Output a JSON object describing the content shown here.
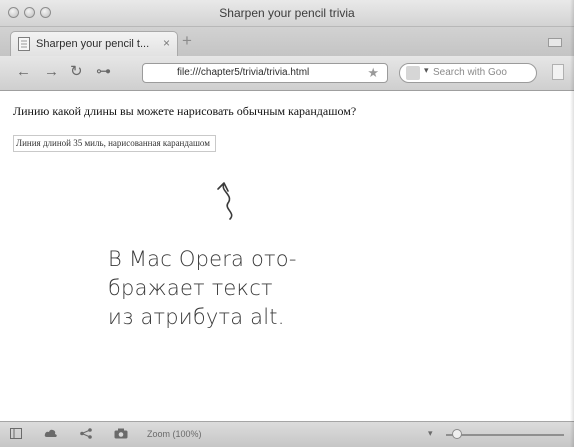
{
  "window": {
    "title": "Sharpen your pencil trivia"
  },
  "tab": {
    "title": "Sharpen your pencil t...",
    "close_glyph": "×",
    "new_tab_glyph": "+"
  },
  "navbar": {
    "back_glyph": "←",
    "forward_glyph": "→",
    "reload_glyph": "↻",
    "home_glyph": "⊶",
    "url": "file:///chapter5/trivia/trivia.html",
    "bookmark_glyph": "★",
    "search_placeholder": "Search with Goo",
    "search_dropdown_glyph": "▾"
  },
  "page": {
    "question": "Линию какой длины вы можете нарисовать обычным карандашом?",
    "alt_text": "Линия длиной 35 миль, нарисованная карандашом"
  },
  "annotation": {
    "lines": [
      "В Mac Opera ото-",
      "бражает текст",
      "из атрибута alt."
    ]
  },
  "statusbar": {
    "zoom_label": "Zoom (100%)",
    "zoom_dropdown_glyph": "▾",
    "zoom_level_percent": 100
  },
  "icons": {
    "traffic_lights": [
      "close-icon",
      "minimize-icon",
      "zoom-icon"
    ],
    "tab_favicon": "page-icon",
    "navbar": [
      "back-arrow-icon",
      "forward-arrow-icon",
      "reload-icon",
      "home-icon",
      "star-icon",
      "search-engine-icon",
      "page-icon"
    ],
    "statusbar": [
      "panel-icon",
      "cloud-icon",
      "share-icon",
      "camera-icon"
    ],
    "annotation": "hand-drawn-arrow-icon"
  },
  "colors": {
    "chrome_light": "#e6e6e6",
    "chrome_dark": "#cfcfcf",
    "page_background": "#ffffff",
    "handwriting": "#3a3a3a"
  }
}
